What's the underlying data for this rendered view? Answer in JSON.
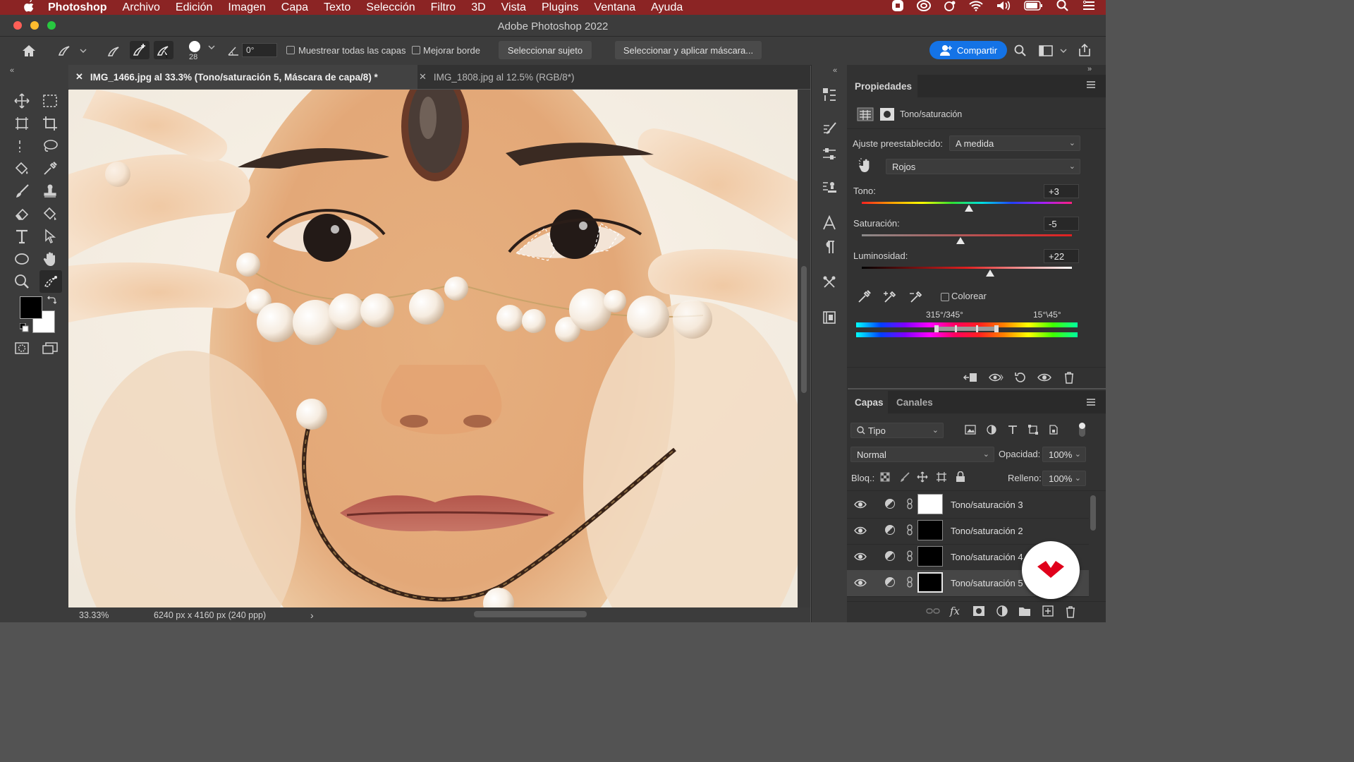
{
  "menubar": {
    "apple": "",
    "app": "Photoshop",
    "items": [
      "Archivo",
      "Edición",
      "Imagen",
      "Capa",
      "Texto",
      "Selección",
      "Filtro",
      "3D",
      "Vista",
      "Plugins",
      "Ventana",
      "Ayuda"
    ]
  },
  "window": {
    "title": "Adobe Photoshop 2022"
  },
  "options": {
    "brush_size": "28",
    "angle": "0°",
    "sample_all_layers": "Muestrear todas las capas",
    "enhance_edge": "Mejorar borde",
    "select_subject": "Seleccionar sujeto",
    "select_and_mask": "Seleccionar y aplicar máscara...",
    "share": "Compartir"
  },
  "tabs": [
    {
      "label": "IMG_1466.jpg al 33.3% (Tono/saturación 5, Máscara de capa/8) *",
      "active": true
    },
    {
      "label": "IMG_1808.jpg al 12.5% (RGB/8*)",
      "active": false
    }
  ],
  "status": {
    "zoom": "33.33%",
    "dimensions": "6240 px x 4160 px (240 ppp)",
    "arrow": "›"
  },
  "properties": {
    "title": "Propiedades",
    "adjustment": "Tono/saturación",
    "preset_label": "Ajuste preestablecido:",
    "preset_value": "A medida",
    "channel": "Rojos",
    "hue": {
      "label": "Tono:",
      "value": "+3",
      "fraction": 0.51
    },
    "saturation": {
      "label": "Saturación:",
      "value": "-5",
      "fraction": 0.47
    },
    "lightness": {
      "label": "Luminosidad:",
      "value": "+22",
      "fraction": 0.61
    },
    "colorize": "Colorear",
    "range_left": "315°/345°",
    "range_right": "15°\\45°"
  },
  "layers_panel": {
    "tab_layers": "Capas",
    "tab_channels": "Canales",
    "filter": "Tipo",
    "blend_mode": "Normal",
    "opacity_label": "Opacidad:",
    "opacity_value": "100%",
    "lock_label": "Bloq.:",
    "fill_label": "Relleno:",
    "fill_value": "100%",
    "layers": [
      {
        "name": "Tono/saturación 3",
        "mask": "white"
      },
      {
        "name": "Tono/saturación 2",
        "mask": "black"
      },
      {
        "name": "Tono/saturación 4",
        "mask": "black"
      },
      {
        "name": "Tono/saturación 5",
        "mask": "black",
        "selected": true
      }
    ]
  },
  "colors": {
    "menubar": "#8b2424",
    "panel": "#323232",
    "chrome": "#3c3c3c",
    "accent": "#1473e6"
  }
}
